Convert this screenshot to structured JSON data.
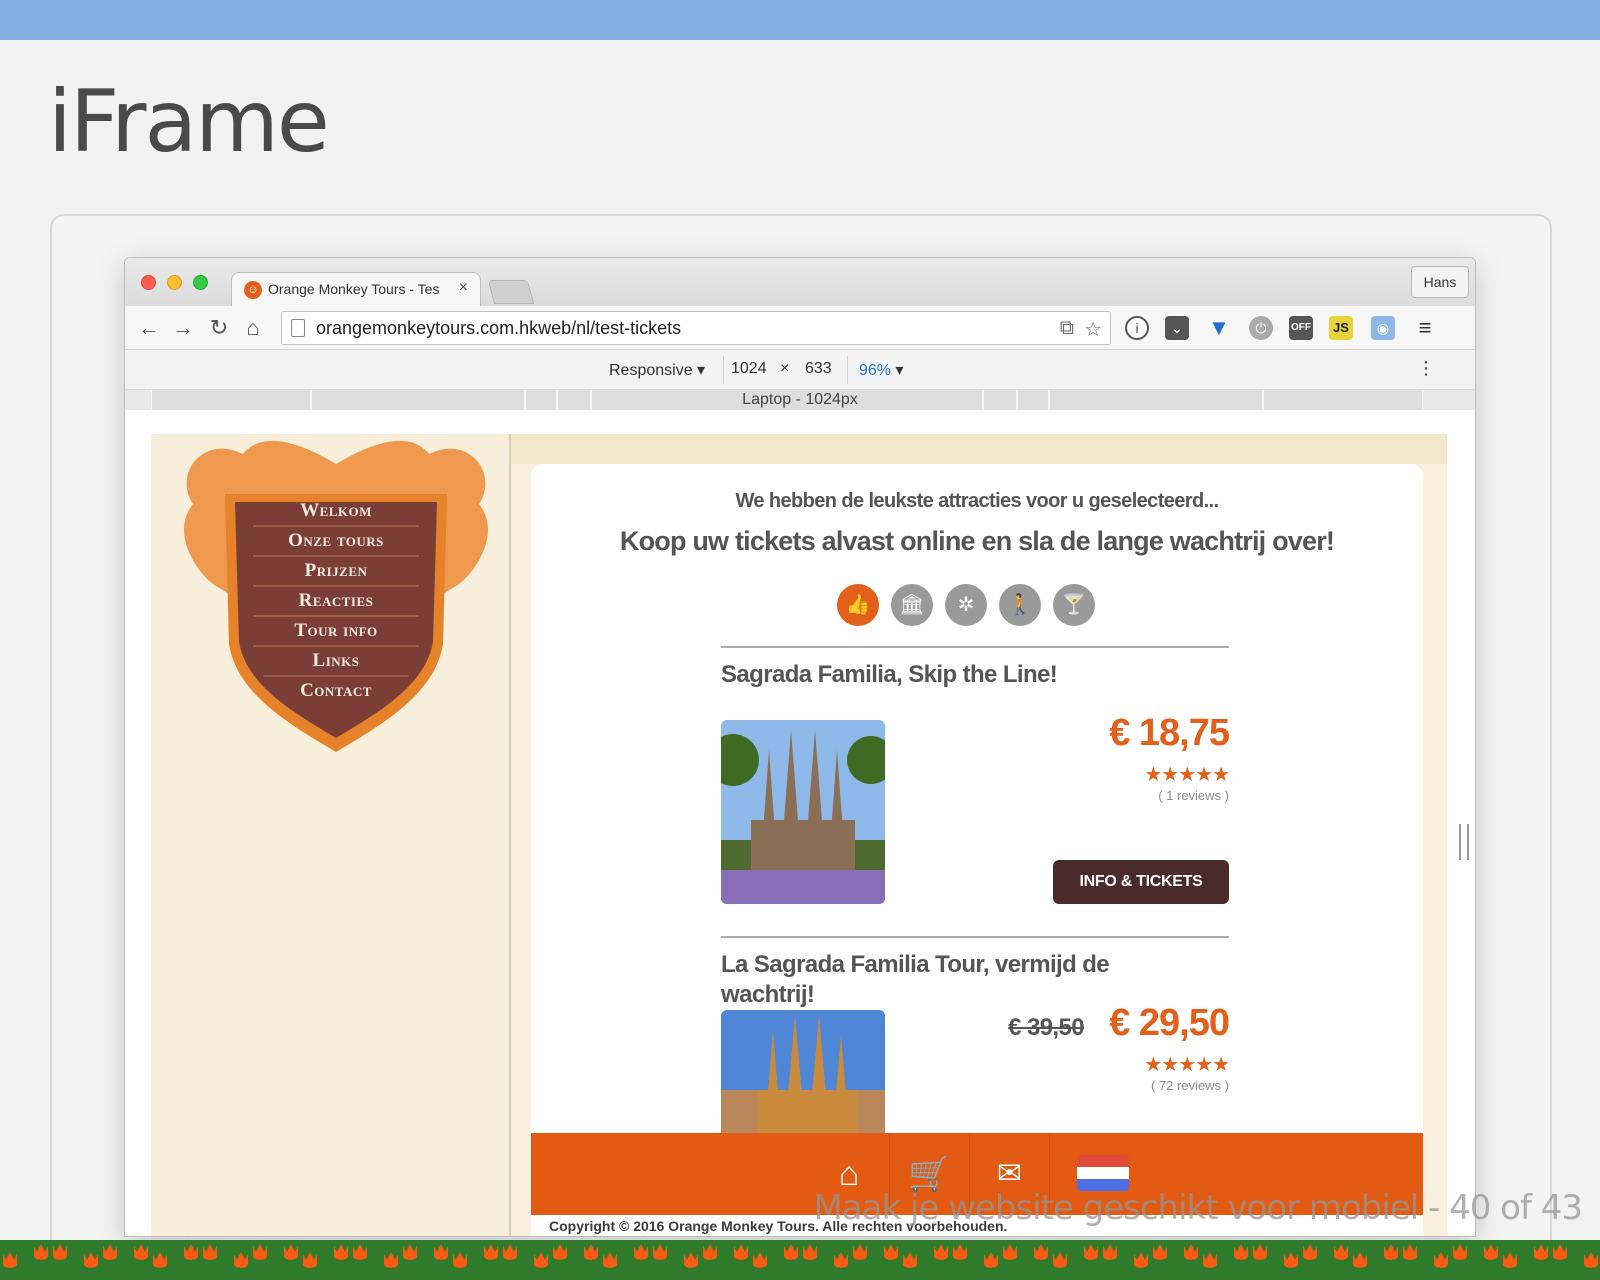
{
  "slide": {
    "title": "iFrame",
    "footer": "Maak je website geschikt voor mobiel - 40 of 43"
  },
  "browser": {
    "tab_title": "Orange Monkey Tours - Tes",
    "tab_close": "×",
    "profile": "Hans",
    "url": "orangemonkeytours.com.hkweb/nl/test-tickets",
    "nav": {
      "back": "←",
      "forward": "→",
      "reload": "↻",
      "home": "⌂"
    },
    "extensions": [
      "info-icon",
      "pocket-icon",
      "shield-icon",
      "power-icon",
      "off-icon",
      "js-icon",
      "camera-icon",
      "menu-icon"
    ],
    "extension_text": {
      "off": "OFF",
      "js": "JS"
    }
  },
  "devtools": {
    "device": "Responsive",
    "width": "1024",
    "height": "633",
    "zoom": "96%",
    "times": "×",
    "media_label": "Laptop - 1024px"
  },
  "site": {
    "menu": [
      "Welkom",
      "Onze tours",
      "Prijzen",
      "Reacties",
      "Tour info",
      "Links",
      "Contact"
    ],
    "tagline": "We hebben de leukste attracties voor u geselecteerd...",
    "headline": "Koop uw tickets alvast online en sla de lange wachtrij over!",
    "categories": [
      "thumbs-up-icon",
      "museum-icon",
      "ferris-wheel-icon",
      "walking-icon",
      "cocktail-icon"
    ],
    "products": [
      {
        "title": "Sagrada Familia, Skip the Line!",
        "price": "€ 18,75",
        "old_price": "",
        "stars": "★★★★★",
        "reviews": "( 1 reviews )",
        "button": "INFO & TICKETS"
      },
      {
        "title": "La Sagrada Familia Tour, vermijd de wachtrij!",
        "price": "€ 29,50",
        "old_price": "€ 39,50",
        "stars": "★★★★★",
        "reviews": "( 72 reviews )",
        "button": ""
      }
    ],
    "bottom_nav": [
      "home-icon",
      "cart-icon",
      "mail-icon",
      "language-flag-nl"
    ],
    "copyright": "Copyright © 2016 Orange Monkey Tours. Alle rechten voorbehouden.",
    "colors": {
      "accent": "#e2601a",
      "button": "#4a2a2b",
      "crest": "#7a3e36"
    }
  }
}
